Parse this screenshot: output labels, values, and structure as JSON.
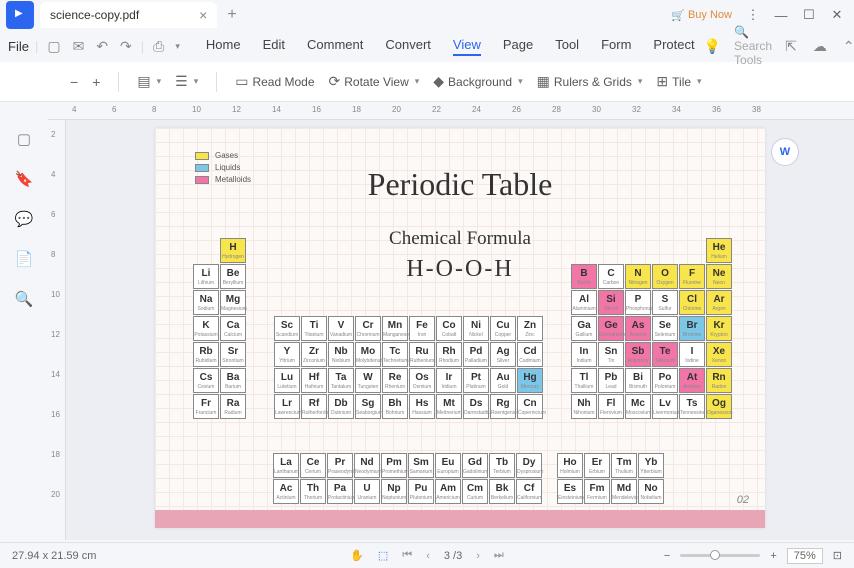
{
  "tab": {
    "title": "science-copy.pdf"
  },
  "titlebar": {
    "buy_now": "Buy Now"
  },
  "menubar": {
    "file": "File",
    "items": [
      "Home",
      "Edit",
      "Comment",
      "Convert",
      "View",
      "Page",
      "Tool",
      "Form",
      "Protect"
    ],
    "active_idx": 4,
    "search_placeholder": "Search Tools"
  },
  "toolbar": {
    "minus": "−",
    "plus": "+",
    "read_mode": "Read Mode",
    "rotate_view": "Rotate View",
    "background": "Background",
    "rulers_grids": "Rulers & Grids",
    "tile": "Tile"
  },
  "ruler_h_marks": [
    4,
    6,
    8,
    10,
    12,
    14,
    16,
    18,
    20,
    22,
    24,
    26,
    28,
    30,
    32,
    34,
    36,
    38
  ],
  "ruler_v_marks": [
    2,
    4,
    6,
    8,
    10,
    12,
    14,
    16,
    18,
    20
  ],
  "legend": [
    {
      "label": "Gases",
      "color": "#f8e54b"
    },
    {
      "label": "Liquids",
      "color": "#7cc7e8"
    },
    {
      "label": "Metalloids",
      "color": "#f275a8"
    }
  ],
  "doc": {
    "title": "Periodic Table",
    "subtitle": "Chemical Formula",
    "formula": "H-O-O-H",
    "pgno": "02"
  },
  "statusbar": {
    "dims": "27.94 x 21.59 cm",
    "page": "3 /3",
    "zoom": "75%"
  },
  "elements": [
    {
      "s": "H",
      "n": "Hydrogen",
      "r": 0,
      "c": 1,
      "cls": "ylw"
    },
    {
      "s": "He",
      "n": "Helium",
      "r": 0,
      "c": 17,
      "cls": "ylw"
    },
    {
      "s": "Li",
      "n": "Lithium",
      "r": 1,
      "c": 0
    },
    {
      "s": "Be",
      "n": "Beryllium",
      "r": 1,
      "c": 1
    },
    {
      "s": "B",
      "n": "Boron",
      "r": 1,
      "c": 12,
      "cls": "pnk"
    },
    {
      "s": "C",
      "n": "Carbon",
      "r": 1,
      "c": 13
    },
    {
      "s": "N",
      "n": "Nitrogen",
      "r": 1,
      "c": 14,
      "cls": "ylw"
    },
    {
      "s": "O",
      "n": "Oxygen",
      "r": 1,
      "c": 15,
      "cls": "ylw"
    },
    {
      "s": "F",
      "n": "Fluorine",
      "r": 1,
      "c": 16,
      "cls": "ylw"
    },
    {
      "s": "Ne",
      "n": "Neon",
      "r": 1,
      "c": 17,
      "cls": "ylw"
    },
    {
      "s": "Na",
      "n": "Sodium",
      "r": 2,
      "c": 0
    },
    {
      "s": "Mg",
      "n": "Magnesium",
      "r": 2,
      "c": 1
    },
    {
      "s": "Al",
      "n": "Aluminium",
      "r": 2,
      "c": 12
    },
    {
      "s": "Si",
      "n": "Silicon",
      "r": 2,
      "c": 13,
      "cls": "pnk"
    },
    {
      "s": "P",
      "n": "Phosphorus",
      "r": 2,
      "c": 14
    },
    {
      "s": "S",
      "n": "Sulfur",
      "r": 2,
      "c": 15
    },
    {
      "s": "Cl",
      "n": "Chlorine",
      "r": 2,
      "c": 16,
      "cls": "ylw"
    },
    {
      "s": "Ar",
      "n": "Argon",
      "r": 2,
      "c": 17,
      "cls": "ylw"
    },
    {
      "s": "K",
      "n": "Potassium",
      "r": 3,
      "c": 0
    },
    {
      "s": "Ca",
      "n": "Calcium",
      "r": 3,
      "c": 1
    },
    {
      "s": "Sc",
      "n": "Scandium",
      "r": 3,
      "c": 2
    },
    {
      "s": "Ti",
      "n": "Titanium",
      "r": 3,
      "c": 3
    },
    {
      "s": "V",
      "n": "Vanadium",
      "r": 3,
      "c": 4
    },
    {
      "s": "Cr",
      "n": "Chromium",
      "r": 3,
      "c": 5
    },
    {
      "s": "Mn",
      "n": "Manganese",
      "r": 3,
      "c": 6
    },
    {
      "s": "Fe",
      "n": "Iron",
      "r": 3,
      "c": 7
    },
    {
      "s": "Co",
      "n": "Cobalt",
      "r": 3,
      "c": 8
    },
    {
      "s": "Ni",
      "n": "Nickel",
      "r": 3,
      "c": 9
    },
    {
      "s": "Cu",
      "n": "Copper",
      "r": 3,
      "c": 10
    },
    {
      "s": "Zn",
      "n": "Zinc",
      "r": 3,
      "c": 11
    },
    {
      "s": "Ga",
      "n": "Gallium",
      "r": 3,
      "c": 12
    },
    {
      "s": "Ge",
      "n": "Germanium",
      "r": 3,
      "c": 13,
      "cls": "pnk"
    },
    {
      "s": "As",
      "n": "Arsenic",
      "r": 3,
      "c": 14,
      "cls": "pnk"
    },
    {
      "s": "Se",
      "n": "Selenium",
      "r": 3,
      "c": 15
    },
    {
      "s": "Br",
      "n": "Bromine",
      "r": 3,
      "c": 16,
      "cls": "blu"
    },
    {
      "s": "Kr",
      "n": "Krypton",
      "r": 3,
      "c": 17,
      "cls": "ylw"
    },
    {
      "s": "Rb",
      "n": "Rubidium",
      "r": 4,
      "c": 0
    },
    {
      "s": "Sr",
      "n": "Strontium",
      "r": 4,
      "c": 1
    },
    {
      "s": "Y",
      "n": "Yttrium",
      "r": 4,
      "c": 2
    },
    {
      "s": "Zr",
      "n": "Zirconium",
      "r": 4,
      "c": 3
    },
    {
      "s": "Nb",
      "n": "Niobium",
      "r": 4,
      "c": 4
    },
    {
      "s": "Mo",
      "n": "Molybdenum",
      "r": 4,
      "c": 5
    },
    {
      "s": "Tc",
      "n": "Technetium",
      "r": 4,
      "c": 6
    },
    {
      "s": "Ru",
      "n": "Ruthenium",
      "r": 4,
      "c": 7
    },
    {
      "s": "Rh",
      "n": "Rhodium",
      "r": 4,
      "c": 8
    },
    {
      "s": "Pd",
      "n": "Palladium",
      "r": 4,
      "c": 9
    },
    {
      "s": "Ag",
      "n": "Silver",
      "r": 4,
      "c": 10
    },
    {
      "s": "Cd",
      "n": "Cadmium",
      "r": 4,
      "c": 11
    },
    {
      "s": "In",
      "n": "Indium",
      "r": 4,
      "c": 12
    },
    {
      "s": "Sn",
      "n": "Tin",
      "r": 4,
      "c": 13
    },
    {
      "s": "Sb",
      "n": "Antimony",
      "r": 4,
      "c": 14,
      "cls": "pnk"
    },
    {
      "s": "Te",
      "n": "Tellurium",
      "r": 4,
      "c": 15,
      "cls": "pnk"
    },
    {
      "s": "I",
      "n": "Iodine",
      "r": 4,
      "c": 16
    },
    {
      "s": "Xe",
      "n": "Xenon",
      "r": 4,
      "c": 17,
      "cls": "ylw"
    },
    {
      "s": "Cs",
      "n": "Cesium",
      "r": 5,
      "c": 0
    },
    {
      "s": "Ba",
      "n": "Barium",
      "r": 5,
      "c": 1
    },
    {
      "s": "Lu",
      "n": "Lutetium",
      "r": 5,
      "c": 2
    },
    {
      "s": "Hf",
      "n": "Hafnium",
      "r": 5,
      "c": 3
    },
    {
      "s": "Ta",
      "n": "Tantalum",
      "r": 5,
      "c": 4
    },
    {
      "s": "W",
      "n": "Tungsten",
      "r": 5,
      "c": 5
    },
    {
      "s": "Re",
      "n": "Rhenium",
      "r": 5,
      "c": 6
    },
    {
      "s": "Os",
      "n": "Osmium",
      "r": 5,
      "c": 7
    },
    {
      "s": "Ir",
      "n": "Iridium",
      "r": 5,
      "c": 8
    },
    {
      "s": "Pt",
      "n": "Platinum",
      "r": 5,
      "c": 9
    },
    {
      "s": "Au",
      "n": "Gold",
      "r": 5,
      "c": 10
    },
    {
      "s": "Hg",
      "n": "Mercury",
      "r": 5,
      "c": 11,
      "cls": "blu"
    },
    {
      "s": "Tl",
      "n": "Thallium",
      "r": 5,
      "c": 12
    },
    {
      "s": "Pb",
      "n": "Lead",
      "r": 5,
      "c": 13
    },
    {
      "s": "Bi",
      "n": "Bismuth",
      "r": 5,
      "c": 14
    },
    {
      "s": "Po",
      "n": "Polonium",
      "r": 5,
      "c": 15
    },
    {
      "s": "At",
      "n": "Astatine",
      "r": 5,
      "c": 16,
      "cls": "pnk"
    },
    {
      "s": "Rn",
      "n": "Radon",
      "r": 5,
      "c": 17,
      "cls": "ylw"
    },
    {
      "s": "Fr",
      "n": "Francium",
      "r": 6,
      "c": 0
    },
    {
      "s": "Ra",
      "n": "Radium",
      "r": 6,
      "c": 1
    },
    {
      "s": "Lr",
      "n": "Lawrencium",
      "r": 6,
      "c": 2
    },
    {
      "s": "Rf",
      "n": "Rutherfordium",
      "r": 6,
      "c": 3
    },
    {
      "s": "Db",
      "n": "Dubnium",
      "r": 6,
      "c": 4
    },
    {
      "s": "Sg",
      "n": "Seaborgium",
      "r": 6,
      "c": 5
    },
    {
      "s": "Bh",
      "n": "Bohrium",
      "r": 6,
      "c": 6
    },
    {
      "s": "Hs",
      "n": "Hassium",
      "r": 6,
      "c": 7
    },
    {
      "s": "Mt",
      "n": "Meitnerium",
      "r": 6,
      "c": 8
    },
    {
      "s": "Ds",
      "n": "Darmstadtium",
      "r": 6,
      "c": 9
    },
    {
      "s": "Rg",
      "n": "Roentgenium",
      "r": 6,
      "c": 10
    },
    {
      "s": "Cn",
      "n": "Copernicium",
      "r": 6,
      "c": 11
    },
    {
      "s": "Nh",
      "n": "Nihonium",
      "r": 6,
      "c": 12
    },
    {
      "s": "Fl",
      "n": "Flerovium",
      "r": 6,
      "c": 13
    },
    {
      "s": "Mc",
      "n": "Moscovium",
      "r": 6,
      "c": 14
    },
    {
      "s": "Lv",
      "n": "Livermorium",
      "r": 6,
      "c": 15
    },
    {
      "s": "Ts",
      "n": "Tennessine",
      "r": 6,
      "c": 16
    },
    {
      "s": "Og",
      "n": "Oganesson",
      "r": 6,
      "c": 17,
      "cls": "ylw"
    }
  ],
  "fblock": [
    {
      "s": "La",
      "n": "Lanthanum",
      "r": 0,
      "c": 0
    },
    {
      "s": "Ce",
      "n": "Cerium",
      "r": 0,
      "c": 1
    },
    {
      "s": "Pr",
      "n": "Praseodymium",
      "r": 0,
      "c": 2
    },
    {
      "s": "Nd",
      "n": "Neodymium",
      "r": 0,
      "c": 3
    },
    {
      "s": "Pm",
      "n": "Promethium",
      "r": 0,
      "c": 4
    },
    {
      "s": "Sm",
      "n": "Samarium",
      "r": 0,
      "c": 5
    },
    {
      "s": "Eu",
      "n": "Europium",
      "r": 0,
      "c": 6
    },
    {
      "s": "Gd",
      "n": "Gadolinium",
      "r": 0,
      "c": 7
    },
    {
      "s": "Tb",
      "n": "Terbium",
      "r": 0,
      "c": 8
    },
    {
      "s": "Dy",
      "n": "Dysprosium",
      "r": 0,
      "c": 9
    },
    {
      "s": "Ho",
      "n": "Holmium",
      "r": 0,
      "c": 10
    },
    {
      "s": "Er",
      "n": "Erbium",
      "r": 0,
      "c": 11
    },
    {
      "s": "Tm",
      "n": "Thulium",
      "r": 0,
      "c": 12
    },
    {
      "s": "Yb",
      "n": "Ytterbium",
      "r": 0,
      "c": 13
    },
    {
      "s": "Ac",
      "n": "Actinium",
      "r": 1,
      "c": 0
    },
    {
      "s": "Th",
      "n": "Thorium",
      "r": 1,
      "c": 1
    },
    {
      "s": "Pa",
      "n": "Protactinium",
      "r": 1,
      "c": 2
    },
    {
      "s": "U",
      "n": "Uranium",
      "r": 1,
      "c": 3
    },
    {
      "s": "Np",
      "n": "Neptunium",
      "r": 1,
      "c": 4
    },
    {
      "s": "Pu",
      "n": "Plutonium",
      "r": 1,
      "c": 5
    },
    {
      "s": "Am",
      "n": "Americium",
      "r": 1,
      "c": 6
    },
    {
      "s": "Cm",
      "n": "Curium",
      "r": 1,
      "c": 7
    },
    {
      "s": "Bk",
      "n": "Berkelium",
      "r": 1,
      "c": 8
    },
    {
      "s": "Cf",
      "n": "Californium",
      "r": 1,
      "c": 9
    },
    {
      "s": "Es",
      "n": "Einsteinium",
      "r": 1,
      "c": 10
    },
    {
      "s": "Fm",
      "n": "Fermium",
      "r": 1,
      "c": 11
    },
    {
      "s": "Md",
      "n": "Mendelevium",
      "r": 1,
      "c": 12
    },
    {
      "s": "No",
      "n": "Nobelium",
      "r": 1,
      "c": 13
    }
  ]
}
